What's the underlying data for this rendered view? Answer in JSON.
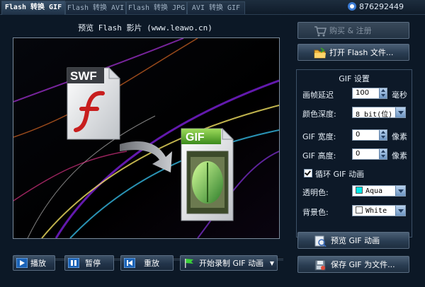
{
  "tabs": [
    {
      "label": "Flash 转换 GIF",
      "active": true
    },
    {
      "label": "Flash 转换 AVI",
      "active": false
    },
    {
      "label": "Flash 转换 JPG",
      "active": false
    },
    {
      "label": "AVI 转换 GIF",
      "active": false
    }
  ],
  "contact": {
    "qq_number": "876292449"
  },
  "preview": {
    "title": "预览 Flash 影片 (www.leawo.cn)",
    "swf_label": "SWF",
    "gif_label": "GIF"
  },
  "controls": {
    "play_label": "播放",
    "pause_label": "暂停",
    "replay_label": "重放",
    "record_label": "开始录制 GIF 动画"
  },
  "sidebar": {
    "buy_label": "购买 & 注册",
    "open_label": "打开 Flash 文件...",
    "preview_gif_label": "预览 GIF 动画",
    "save_gif_label": "保存 GIF 为文件..."
  },
  "settings": {
    "title": "GIF 设置",
    "frame_delay_label": "画帧延迟",
    "frame_delay_value": "100",
    "frame_delay_unit": "毫秒",
    "color_depth_label": "颜色深度:",
    "color_depth_value": "8 bit(位)",
    "width_label": "GIF 宽度:",
    "width_value": "0",
    "width_unit": "像素",
    "height_label": "GIF 高度:",
    "height_value": "0",
    "height_unit": "像素",
    "loop_label": "循环 GIF 动画",
    "transparent_label": "透明色:",
    "transparent_value": "Aqua",
    "transparent_color": "#00e5e5",
    "background_label": "背景色:",
    "background_value": "White",
    "background_color": "#ffffff"
  }
}
